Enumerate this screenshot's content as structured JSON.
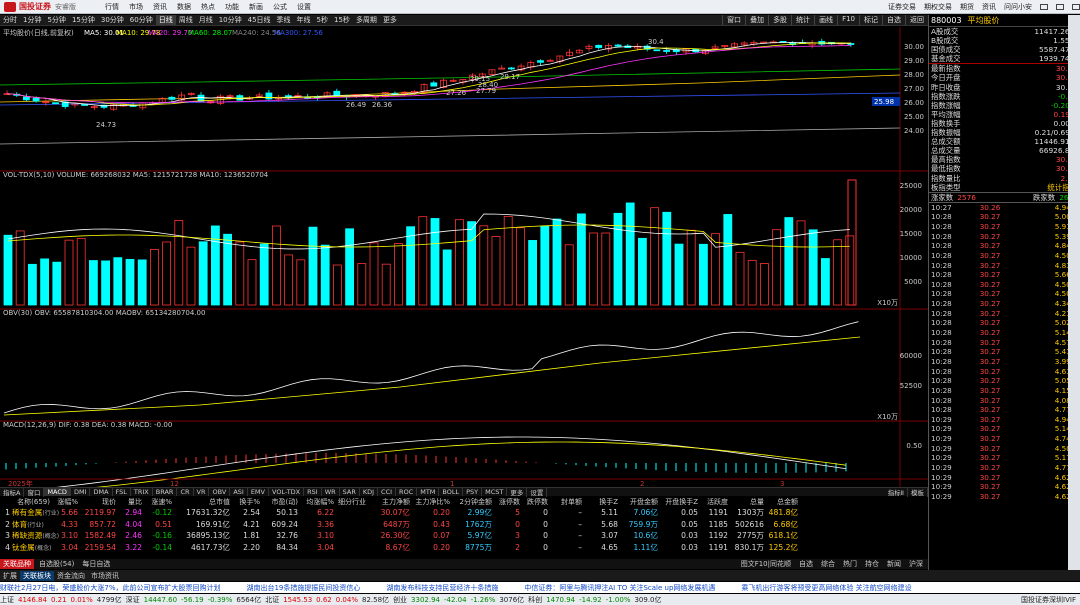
{
  "app": {
    "brand": "国投证券",
    "edition": "安睿版",
    "menus": [
      "行情",
      "市场",
      "资讯",
      "数据",
      "热点",
      "功能",
      "新画",
      "公式",
      "设置"
    ],
    "right_menus": [
      "证券交易",
      "期权交易",
      "期货",
      "资讯",
      "问问小安"
    ]
  },
  "periods": [
    "分时",
    "1分钟",
    "5分钟",
    "15分钟",
    "30分钟",
    "60分钟",
    "日线",
    "周线",
    "月线",
    "10分钟",
    "45日线",
    "季线",
    "年线",
    "5秒",
    "15秒",
    "多周期",
    "更多"
  ],
  "active_period": "日线",
  "toolbar_right": [
    "窗口",
    "叠加",
    "多股",
    "统计",
    "画线",
    "F10",
    "标记",
    "自选",
    "返回"
  ],
  "kline": {
    "title": "平均股价(日线,前复权)",
    "ma_labels": [
      "MA5: 30.01",
      "MA10: 29.78",
      "MA20: 29.70",
      "MA60: 28.07",
      "MA240: 24.56",
      "MA300: 27.56"
    ],
    "ma_colors": [
      "#ffffff",
      "#ffff00",
      "#ff33ff",
      "#00ff00",
      "#888888",
      "#3355ff"
    ],
    "y_ticks": [
      "30.00",
      "29.00",
      "28.00",
      "27.00",
      "26.00",
      "25.00",
      "24.00"
    ],
    "annotations": [
      "30.4",
      "24.73",
      "29.15",
      "29.17",
      "28.40",
      "26.49",
      "26.36",
      "27.26",
      "27.79"
    ],
    "current_price_tag": "25.98",
    "x_labels": [
      "2025年",
      "12",
      "1",
      "2",
      "3"
    ]
  },
  "volume": {
    "title": "VOL-TDX(5,10) VOLUME: 669268032 MA5: 1215721728 MA10: 1236520704",
    "y_ticks": [
      "25000",
      "20000",
      "15000",
      "10000",
      "5000"
    ],
    "unit": "X10万"
  },
  "obv": {
    "title": "OBV(30) OBV: 65587810304.00 MAOBV: 65134280704.00",
    "y_ticks": [
      "60000",
      "52500"
    ],
    "unit": "X10万"
  },
  "macd": {
    "title": "MACD(12,26,9) DIF: 0.38 DEA: 0.38 MACD: -0.00",
    "y_ticks": [
      "0.50"
    ]
  },
  "indicators": [
    "指标A",
    "窗口",
    "MACD",
    "DMI",
    "DMA",
    "FSL",
    "TRIX",
    "BRAR",
    "CR",
    "VR",
    "OBV",
    "ASI",
    "EMV",
    "VOL-TDX",
    "RSI",
    "WR",
    "SAR",
    "KDJ",
    "CCI",
    "ROC",
    "MTM",
    "BOLL",
    "PSY",
    "MCST",
    "更多",
    "设置"
  ],
  "indicators_right": [
    "指标Ⅱ",
    "模板"
  ],
  "table": {
    "headers": [
      "名称(659)",
      "涨幅%",
      "现价",
      "量比",
      "涨速%",
      "总市值",
      "换手%",
      "市盈(动)",
      "均涨幅%",
      "细分行业",
      "主力净额",
      "主力净比%",
      "2分钟金额",
      "涨停数",
      "跌停数",
      "封单额",
      "换手Z",
      "开盘金额",
      "开盘换手Z",
      "活跃度",
      "总量",
      "总金额"
    ],
    "rows": [
      {
        "idx": "1",
        "name": "稀有金属",
        "tag": "(行业)",
        "chg": "5.66",
        "price": "2119.97",
        "vr": "2.94",
        "spd": "-0.12",
        "cap": "17631.32亿",
        "turn": "2.54",
        "pe": "50.13",
        "avg": "6.22",
        "net": "30.07亿",
        "netr": "0.20",
        "amt2": "2.99亿",
        "up": "5",
        "dn": "0",
        "seal": "–",
        "tz": "5.11",
        "open": "7.06亿",
        "otz": "0.05",
        "act": "1191",
        "vol": "1303万",
        "amt": "481.8亿"
      },
      {
        "idx": "2",
        "name": "体育",
        "tag": "(行业)",
        "chg": "4.33",
        "price": "857.72",
        "vr": "4.04",
        "spd": "0.51",
        "cap": "169.91亿",
        "turn": "4.21",
        "pe": "609.24",
        "avg": "3.36",
        "net": "6487万",
        "netr": "0.43",
        "amt2": "1762万",
        "up": "0",
        "dn": "0",
        "seal": "–",
        "tz": "5.68",
        "open": "759.9万",
        "otz": "0.05",
        "act": "1185",
        "vol": "502616",
        "amt": "6.68亿"
      },
      {
        "idx": "3",
        "name": "稀缺资源",
        "tag": "(概念)",
        "chg": "3.10",
        "price": "1582.49",
        "vr": "2.46",
        "spd": "-0.16",
        "cap": "36895.13亿",
        "turn": "1.81",
        "pe": "32.76",
        "avg": "3.10",
        "net": "26.30亿",
        "netr": "0.07",
        "amt2": "5.97亿",
        "up": "3",
        "dn": "0",
        "seal": "–",
        "tz": "3.07",
        "open": "10.6亿",
        "otz": "0.03",
        "act": "1192",
        "vol": "2775万",
        "amt": "618.1亿"
      },
      {
        "idx": "4",
        "name": "钛金属",
        "tag": "(概念)",
        "chg": "3.04",
        "price": "2159.54",
        "vr": "3.22",
        "spd": "-0.14",
        "cap": "4617.73亿",
        "turn": "2.20",
        "pe": "84.34",
        "avg": "3.04",
        "net": "8.67亿",
        "netr": "0.20",
        "amt2": "8775万",
        "up": "2",
        "dn": "0",
        "seal": "–",
        "tz": "4.65",
        "open": "1.11亿",
        "otz": "0.03",
        "act": "1191",
        "vol": "830.1万",
        "amt": "125.2亿"
      }
    ]
  },
  "bottom_tabs": [
    "关联品种",
    "自选股(54)",
    "每日自选"
  ],
  "bottom_tabs_right": [
    "图文F10|同花顺",
    "自选",
    "综合",
    "热门",
    "持仓",
    "新闻",
    "沪深"
  ],
  "sub_tabs": [
    "扩展",
    "关联板块",
    "资金流向",
    "市场资讯"
  ],
  "ticker": [
    "财联社2月27日电，荣盛股价大涨7%，此前公司宣布扩大股票回购计划",
    "湖南出台19条措施提振民间投资信心",
    "湖南发布科技支持民营经济十条措施",
    "中信证券：阿里与腾讯押注AI TO 关注Scale up网络发展机遇",
    "乘飞机出行游客将预受更高网络体验 关注航空网络建设"
  ],
  "status": [
    {
      "t": "上证",
      "v": "4146.84",
      "c": "0.21",
      "p": "0.01%",
      "a": "4799亿"
    },
    {
      "t": "深证",
      "v": "14447.60",
      "c": "-56.19",
      "p": "-0.39%",
      "a": "6564亿"
    },
    {
      "t": "北证",
      "v": "1545.53",
      "c": "0.62",
      "p": "0.04%",
      "a": "82.58亿"
    },
    {
      "t": "创业",
      "v": "3302.94",
      "c": "-42.04",
      "p": "-1.26%",
      "a": "3076亿"
    },
    {
      "t": "科创",
      "v": "1470.94",
      "c": "-14.92",
      "p": "-1.00%",
      "a": "309.0亿"
    }
  ],
  "status_right": "国投证券深圳IVIF",
  "quote": {
    "code": "880003",
    "name": "平均股价",
    "kv1": [
      [
        "A股成交",
        "11417.26亿",
        "wht"
      ],
      [
        "B股成交",
        "1.55亿",
        "wht"
      ],
      [
        "国债成交",
        "5587.47亿",
        "wht"
      ],
      [
        "基金成交",
        "1939.74亿",
        "wht"
      ]
    ],
    "kv2": [
      [
        "最新指数",
        "30.27",
        "red"
      ],
      [
        "今日开盘",
        "30.12",
        "red"
      ],
      [
        "昨日收盘",
        "30.33",
        "wht"
      ],
      [
        "指数涨跌",
        "-0.06",
        "grn"
      ],
      [
        "指数涨幅",
        "-0.20%",
        "grn"
      ],
      [
        "平均涨幅",
        "0.19%",
        "red"
      ],
      [
        "指数换手",
        "0.00%",
        "wht"
      ],
      [
        "指数振幅",
        "0.21/0.69%",
        "wht"
      ],
      [
        "总成交额",
        "11446.91亿",
        "wht"
      ],
      [
        "总成交量",
        "66926.8万",
        "wht"
      ],
      [
        "最高指数",
        "30.29",
        "red"
      ],
      [
        "最低指数",
        "30.08",
        "red"
      ],
      [
        "指数量比",
        "2.02",
        "red"
      ],
      [
        "板指类型",
        "统计指数",
        "yel"
      ]
    ],
    "up_label": "涨家数",
    "up_count": "2576",
    "down_label": "跌家数",
    "down_count": "2678",
    "ticks": [
      [
        "10:27",
        "30.26",
        "4.94亿"
      ],
      [
        "10:28",
        "30.27",
        "5.00亿"
      ],
      [
        "10:28",
        "30.27",
        "5.91亿"
      ],
      [
        "10:28",
        "30.27",
        "5.39亿"
      ],
      [
        "10:28",
        "30.27",
        "4.84亿"
      ],
      [
        "10:28",
        "30.27",
        "4.50亿"
      ],
      [
        "10:28",
        "30.27",
        "4.83亿"
      ],
      [
        "10:28",
        "30.27",
        "5.66亿"
      ],
      [
        "10:28",
        "30.27",
        "4.50亿"
      ],
      [
        "10:28",
        "30.27",
        "4.50亿"
      ],
      [
        "10:28",
        "30.27",
        "4.34亿"
      ],
      [
        "10:28",
        "30.27",
        "4.21亿"
      ],
      [
        "10:28",
        "30.27",
        "5.02亿"
      ],
      [
        "10:28",
        "30.27",
        "5.14亿"
      ],
      [
        "10:28",
        "30.27",
        "4.57亿"
      ],
      [
        "10:28",
        "30.27",
        "5.41亿"
      ],
      [
        "10:28",
        "30.27",
        "3.99亿"
      ],
      [
        "10:28",
        "30.27",
        "4.61亿"
      ],
      [
        "10:28",
        "30.27",
        "5.05亿"
      ],
      [
        "10:28",
        "30.27",
        "4.15亿"
      ],
      [
        "10:28",
        "30.27",
        "4.08亿"
      ],
      [
        "10:28",
        "30.27",
        "4.77亿"
      ],
      [
        "10:29",
        "30.27",
        "4.94亿"
      ],
      [
        "10:29",
        "30.27",
        "5.14亿"
      ],
      [
        "10:29",
        "30.27",
        "4.74亿"
      ],
      [
        "10:29",
        "30.27",
        "4.50亿"
      ],
      [
        "10:29",
        "30.27",
        "5.17亿"
      ],
      [
        "10:29",
        "30.27",
        "4.77亿"
      ],
      [
        "10:29",
        "30.27",
        "4.62亿"
      ],
      [
        "10:29",
        "30.27",
        "4.62亿"
      ],
      [
        "10:29",
        "30.27",
        "4.62亿"
      ]
    ]
  },
  "colors": {
    "bg": "#000000",
    "up": "#ff3333",
    "down": "#00ffff",
    "brand": "#c8161d"
  }
}
